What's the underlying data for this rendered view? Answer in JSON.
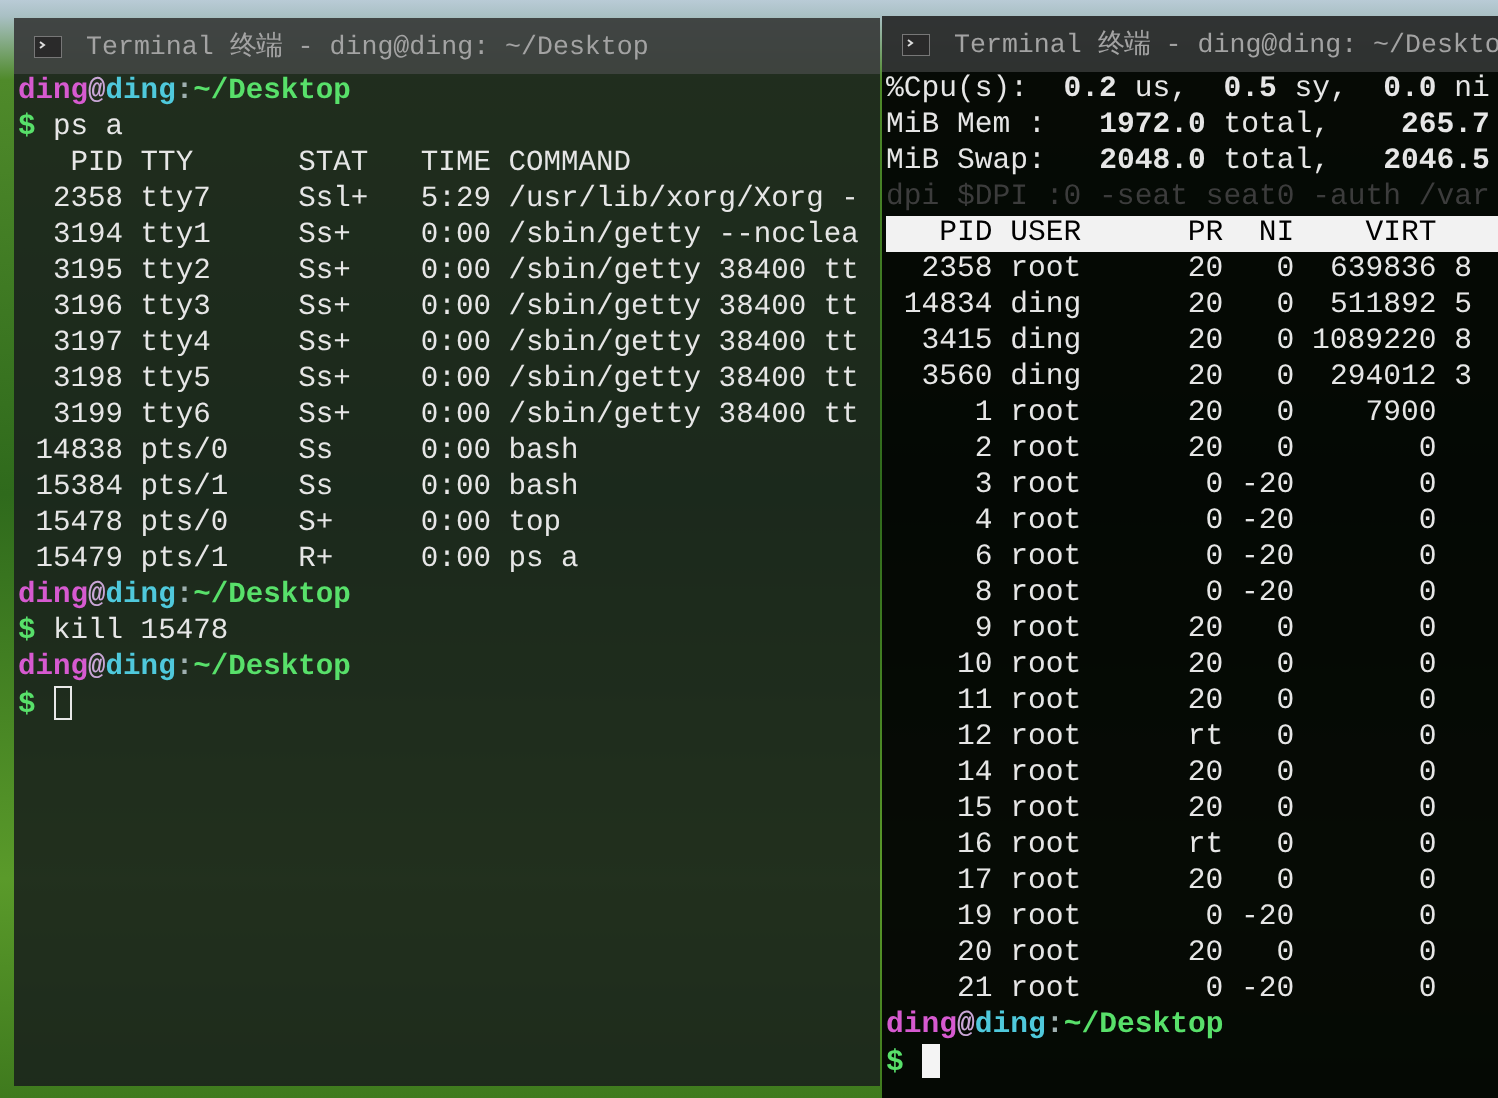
{
  "windows": [
    {
      "title": "Terminal 终端 - ding@ding: ~/Desktop",
      "focused": false,
      "lines": [
        {
          "kind": "prompt",
          "parts": [
            {
              "kind": "user",
              "text": "ding"
            },
            {
              "kind": "at",
              "text": "@"
            },
            {
              "kind": "host",
              "text": "ding"
            },
            {
              "kind": "colon",
              "text": ":"
            },
            {
              "kind": "path",
              "text": "~/Desktop"
            }
          ]
        },
        {
          "kind": "command",
          "symbol": "$",
          "text": "ps a"
        },
        {
          "kind": "output",
          "text": "   PID TTY      STAT   TIME COMMAND"
        },
        {
          "kind": "output",
          "text": "  2358 tty7     Ssl+   5:29 /usr/lib/xorg/Xorg -"
        },
        {
          "kind": "output",
          "text": "  3194 tty1     Ss+    0:00 /sbin/getty --noclea"
        },
        {
          "kind": "output",
          "text": "  3195 tty2     Ss+    0:00 /sbin/getty 38400 tt"
        },
        {
          "kind": "output",
          "text": "  3196 tty3     Ss+    0:00 /sbin/getty 38400 tt"
        },
        {
          "kind": "output",
          "text": "  3197 tty4     Ss+    0:00 /sbin/getty 38400 tt"
        },
        {
          "kind": "output",
          "text": "  3198 tty5     Ss+    0:00 /sbin/getty 38400 tt"
        },
        {
          "kind": "output",
          "text": "  3199 tty6     Ss+    0:00 /sbin/getty 38400 tt"
        },
        {
          "kind": "output",
          "text": " 14838 pts/0    Ss     0:00 bash"
        },
        {
          "kind": "output",
          "text": " 15384 pts/1    Ss     0:00 bash"
        },
        {
          "kind": "output",
          "text": " 15478 pts/0    S+     0:00 top"
        },
        {
          "kind": "output",
          "text": " 15479 pts/1    R+     0:00 ps a"
        },
        {
          "kind": "prompt",
          "parts": [
            {
              "kind": "user",
              "text": "ding"
            },
            {
              "kind": "at",
              "text": "@"
            },
            {
              "kind": "host",
              "text": "ding"
            },
            {
              "kind": "colon",
              "text": ":"
            },
            {
              "kind": "path",
              "text": "~/Desktop"
            }
          ]
        },
        {
          "kind": "command",
          "symbol": "$",
          "text": "kill 15478"
        },
        {
          "kind": "prompt",
          "parts": [
            {
              "kind": "user",
              "text": "ding"
            },
            {
              "kind": "at",
              "text": "@"
            },
            {
              "kind": "host",
              "text": "ding"
            },
            {
              "kind": "colon",
              "text": ":"
            },
            {
              "kind": "path",
              "text": "~/Desktop"
            }
          ]
        },
        {
          "kind": "input",
          "symbol": "$"
        }
      ]
    },
    {
      "title": "Terminal 终端 - ding@ding: ~/Deskto",
      "focused": true,
      "lines": [
        {
          "kind": "summary",
          "text": "%Cpu(s):  **0.2** us,  **0.5** sy,  **0.0** ni"
        },
        {
          "kind": "summary",
          "text": "MiB Mem :   **1972.0** total,    **265.7**"
        },
        {
          "kind": "summary",
          "text": "MiB Swap:   **2048.0** total,   **2046.5**"
        },
        {
          "kind": "dim",
          "text": "dpi $DPI :0 -seat seat0 -auth /var"
        },
        {
          "kind": "table",
          "columns": [
            "PID",
            "USER",
            "PR",
            "NI",
            "VIRT"
          ],
          "rows": [
            [
              "2358",
              "root",
              "20",
              "0",
              "639836",
              "8"
            ],
            [
              "14834",
              "ding",
              "20",
              "0",
              "511892",
              "5"
            ],
            [
              "3415",
              "ding",
              "20",
              "0",
              "1089220",
              "8"
            ],
            [
              "3560",
              "ding",
              "20",
              "0",
              "294012",
              "3"
            ],
            [
              "1",
              "root",
              "20",
              "0",
              "7900"
            ],
            [
              "2",
              "root",
              "20",
              "0",
              "0"
            ],
            [
              "3",
              "root",
              "0",
              "-20",
              "0"
            ],
            [
              "4",
              "root",
              "0",
              "-20",
              "0"
            ],
            [
              "6",
              "root",
              "0",
              "-20",
              "0"
            ],
            [
              "8",
              "root",
              "0",
              "-20",
              "0"
            ],
            [
              "9",
              "root",
              "20",
              "0",
              "0"
            ],
            [
              "10",
              "root",
              "20",
              "0",
              "0"
            ],
            [
              "11",
              "root",
              "20",
              "0",
              "0"
            ],
            [
              "12",
              "root",
              "rt",
              "0",
              "0"
            ],
            [
              "14",
              "root",
              "20",
              "0",
              "0"
            ],
            [
              "15",
              "root",
              "20",
              "0",
              "0"
            ],
            [
              "16",
              "root",
              "rt",
              "0",
              "0"
            ],
            [
              "17",
              "root",
              "20",
              "0",
              "0"
            ],
            [
              "19",
              "root",
              "0",
              "-20",
              "0"
            ],
            [
              "20",
              "root",
              "20",
              "0",
              "0"
            ],
            [
              "21",
              "root",
              "0",
              "-20",
              "0"
            ]
          ]
        },
        {
          "kind": "prompt",
          "parts": [
            {
              "kind": "user",
              "text": "ding"
            },
            {
              "kind": "at",
              "text": "@"
            },
            {
              "kind": "host",
              "text": "ding"
            },
            {
              "kind": "colon",
              "text": ":"
            },
            {
              "kind": "path",
              "text": "~/Desktop"
            }
          ]
        },
        {
          "kind": "input",
          "symbol": "$"
        }
      ]
    }
  ]
}
